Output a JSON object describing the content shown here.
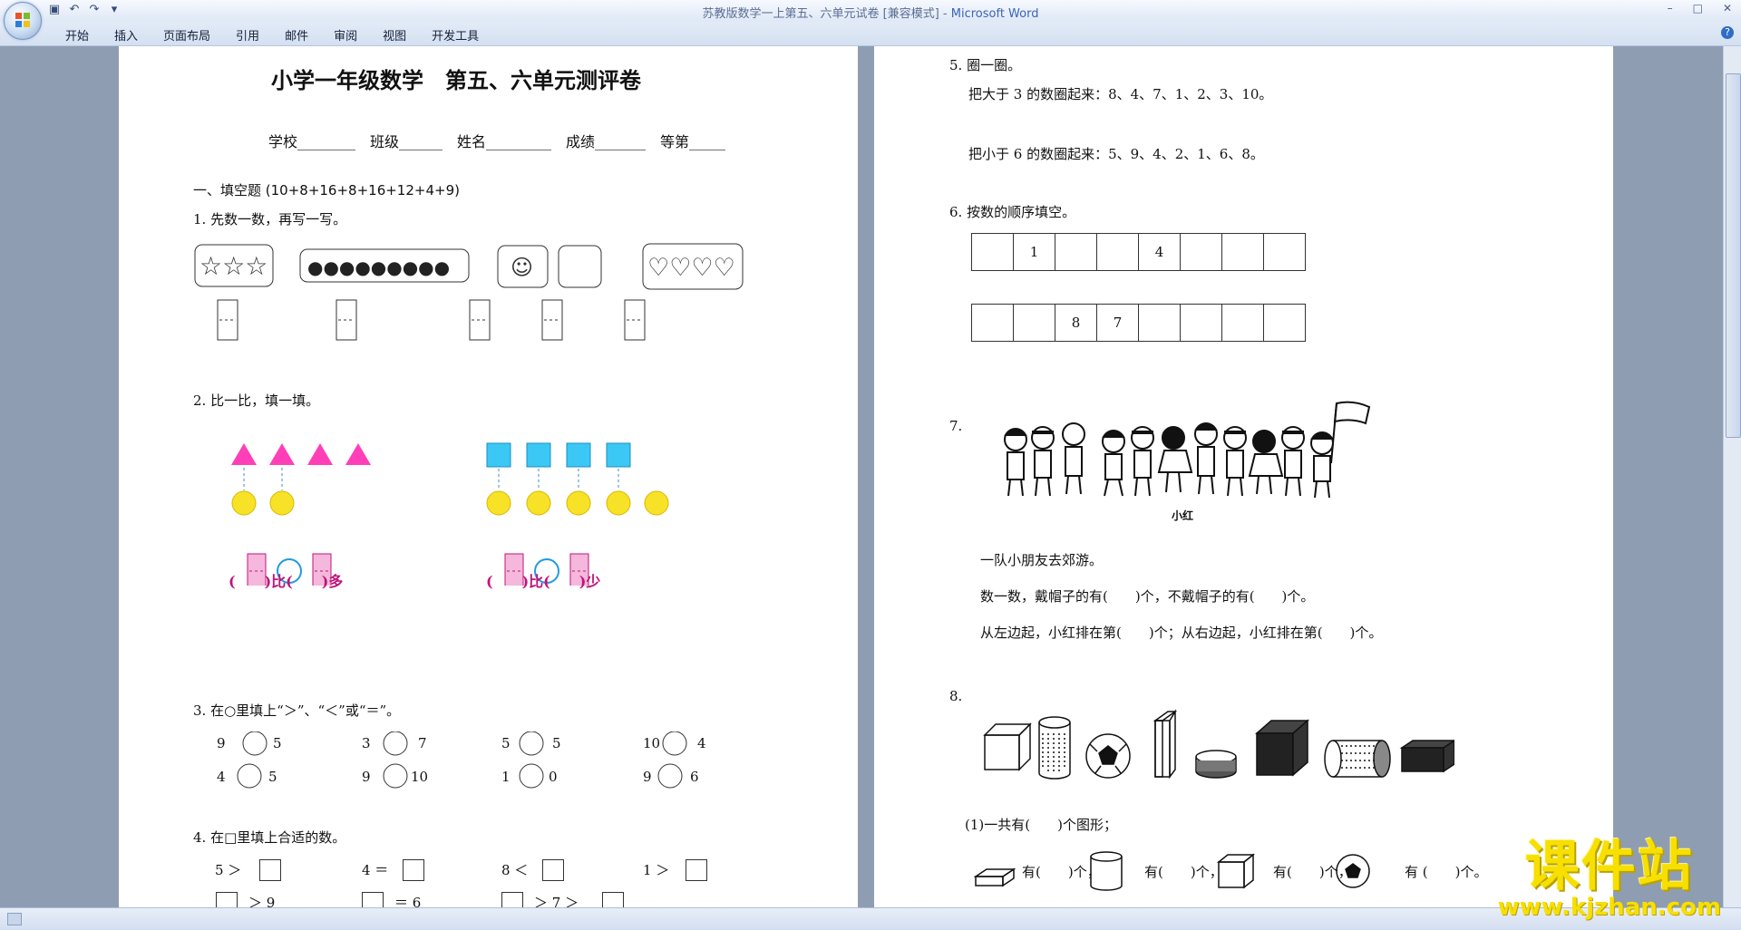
{
  "window": {
    "title": "苏教版数学一上第五、六单元试卷 [兼容模式]",
    "app": "Microsoft Word"
  },
  "menu": [
    "开始",
    "插入",
    "页面布局",
    "引用",
    "邮件",
    "审阅",
    "视图",
    "开发工具"
  ],
  "page1": {
    "title": "小学一年级数学　第五、六单元测评卷",
    "info_line": "学校________　班级______　姓名_________　成绩_______　等第_____",
    "section1": "一、填空题 (10+8+16+8+16+12+4+9)",
    "q1": "1. 先数一数，再写一写。",
    "q2": "2. 比一比，填一填。",
    "q2_left": "(　　)比(　　)多",
    "q2_right": "(　　)比(　　)少",
    "q3": "3. 在○里填上“＞”、“＜”或“＝”。",
    "q3_items": [
      "9",
      "5",
      "3",
      "7",
      "5",
      "5",
      "10",
      "4",
      "4",
      "5",
      "9",
      "10",
      "1",
      "0",
      "9",
      "6"
    ],
    "q4": "4. 在□里填上合适的数。",
    "q4_items": [
      "5 ＞",
      "4 ＝",
      "8 ＜",
      "1 ＞",
      "＞ 9",
      "＝ 6",
      "＞ 7 ＞"
    ]
  },
  "page2": {
    "q5": "5. 圈一圈。",
    "q5_a": "把大于 3 的数圈起来：8、4、7、1、2、3、10。",
    "q5_b": "把小于 6 的数圈起来：5、9、4、2、1、6、8。",
    "q6": "6. 按数的顺序填空。",
    "q6_row1": [
      "",
      "1",
      "",
      "",
      "4",
      "",
      "",
      ""
    ],
    "q6_row2": [
      "",
      "",
      "8",
      "7",
      "",
      "",
      "",
      ""
    ],
    "q7": "7.",
    "q7_caption": "小红",
    "q7_line1": "一队小朋友去郊游。",
    "q7_line2": "数一数，戴帽子的有(　　)个，不戴帽子的有(　　)个。",
    "q7_line3": "从左边起，小红排在第(　　)个；从右边起，小红排在第(　　)个。",
    "q8": "8.",
    "q8_a": "(1)一共有(　　)个图形；",
    "q8_b_labels": [
      "有(　　)个，",
      "有(　　)个，",
      "有(　　)个，",
      "有 (　　)个。"
    ]
  },
  "watermark": {
    "cn": "课件站",
    "url": "www.kjzhan.com"
  },
  "colors": {
    "triangle": "#ff3fb8",
    "square": "#3cc8f5",
    "circle_yellow": "#f7e227",
    "pink_box": "#f5b8dc",
    "blue_circle": "#1e9be0",
    "paren": "#c0147a"
  }
}
